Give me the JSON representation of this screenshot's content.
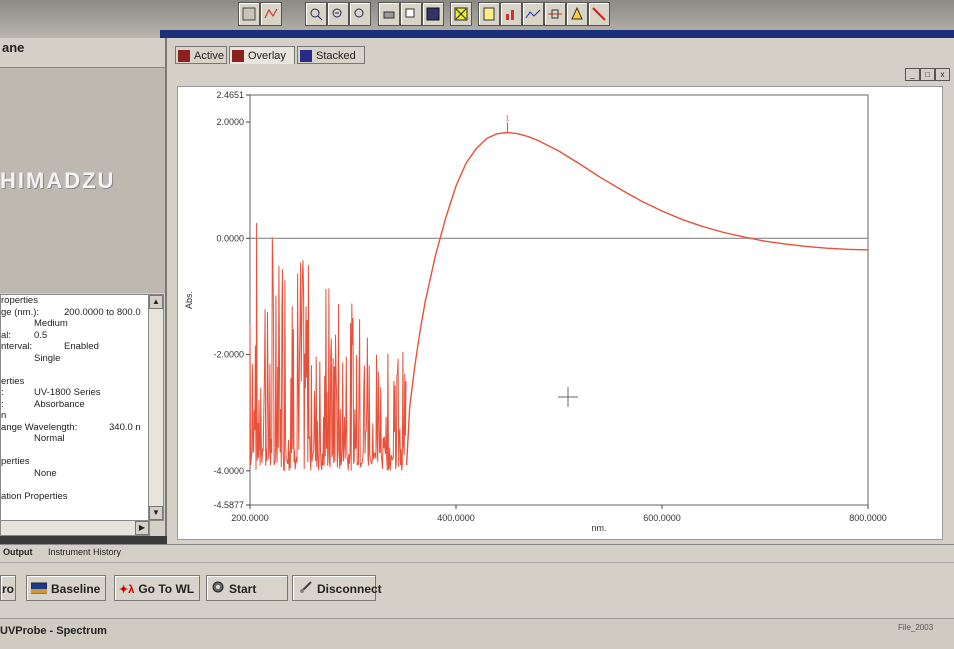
{
  "left_pane": {
    "header": "ane",
    "logo": "HIMADZU",
    "properties": [
      {
        "key": "roperties",
        "value": "",
        "value_wide": ""
      },
      {
        "key": "ge (nm.):",
        "value": "",
        "value_wide": "200.0000 to 800.0"
      },
      {
        "key": "",
        "value": "Medium",
        "value_wide": ""
      },
      {
        "key": "al:",
        "value": "0.5",
        "value_wide": ""
      },
      {
        "key": "nterval:",
        "value": "",
        "value_wide": "Enabled"
      },
      {
        "key": "",
        "value": "Single",
        "value_wide": ""
      },
      {
        "key": "",
        "value": "",
        "value_wide": ""
      },
      {
        "key": "erties",
        "value": "",
        "value_wide": ""
      },
      {
        "key": ":",
        "value": "UV-1800 Series",
        "value_wide": ""
      },
      {
        "key": ":",
        "value": "Absorbance",
        "value_wide": ""
      },
      {
        "key": "n",
        "value": "",
        "value_wide": ""
      },
      {
        "key": "ange Wavelength:",
        "value": "",
        "value_wide": "",
        "value_far": "340.0 n"
      },
      {
        "key": "",
        "value": "Normal",
        "value_wide": ""
      },
      {
        "key": "",
        "value": "",
        "value_wide": ""
      },
      {
        "key": "perties",
        "value": "",
        "value_wide": ""
      },
      {
        "key": "",
        "value": "None",
        "value_wide": ""
      },
      {
        "key": "",
        "value": "",
        "value_wide": ""
      },
      {
        "key": "ation Properties",
        "value": "",
        "value_wide": ""
      }
    ]
  },
  "graph": {
    "tabs": [
      "Active",
      "Overlay",
      "Stacked"
    ],
    "window_buttons": [
      "_",
      "□",
      "x"
    ]
  },
  "chart_data": {
    "type": "line",
    "title": "",
    "xlabel": "nm.",
    "ylabel": "Abs.",
    "xlim": [
      200.0,
      800.0
    ],
    "ylim": [
      -4.5877,
      2.4651
    ],
    "x_ticks": [
      "200.0000",
      "400.0000",
      "600.0000",
      "800.0000"
    ],
    "y_ticks": [
      "2.4651",
      "2.0000",
      "0.0000",
      "-2.0000",
      "-4.0000",
      "-4.5877"
    ],
    "series": [
      {
        "color": "#e8503a",
        "noisy_region": {
          "x_start": 200,
          "x_end": 352,
          "y_min": -4.0,
          "y_max": 0.5
        },
        "x": [
          352,
          355,
          360,
          365,
          370,
          380,
          390,
          400,
          410,
          420,
          430,
          440,
          450,
          460,
          470,
          480,
          500,
          520,
          540,
          560,
          580,
          600,
          620,
          640,
          660,
          680,
          700,
          720,
          740,
          760,
          780,
          800
        ],
        "y": [
          -3.9,
          -2.9,
          -2.2,
          -1.6,
          -1.1,
          -0.3,
          0.35,
          0.9,
          1.3,
          1.55,
          1.72,
          1.8,
          1.82,
          1.8,
          1.75,
          1.68,
          1.5,
          1.28,
          1.05,
          0.84,
          0.64,
          0.47,
          0.32,
          0.2,
          0.1,
          0.02,
          -0.05,
          -0.1,
          -0.14,
          -0.17,
          -0.19,
          -0.2
        ]
      }
    ],
    "baseline": {
      "y": 0.0,
      "color": "#888888"
    },
    "peak_label": {
      "x": 450,
      "y": 1.82,
      "text": "1"
    },
    "grid": false
  },
  "output_tabs": [
    "Output",
    "Instrument History"
  ],
  "bottom_toolbar": {
    "buttons": [
      "ro",
      "Baseline",
      "Go To WL",
      "Start",
      "Disconnect"
    ]
  },
  "status": {
    "left": "UVProbe - Spectrum",
    "right": "File_2003"
  }
}
